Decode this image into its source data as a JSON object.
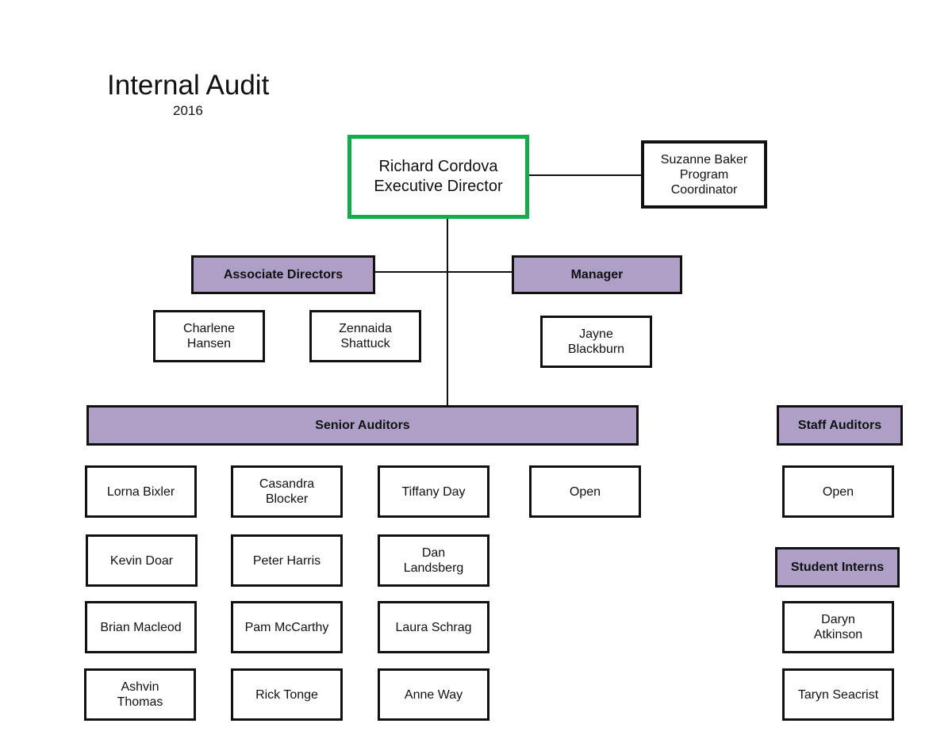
{
  "title": "Internal Audit",
  "year": "2016",
  "colors": {
    "executive_border": "#12ad4b",
    "header_fill": "#ae9fc6",
    "border": "#111111"
  },
  "executive": {
    "name": "Richard Cordova",
    "role": "Executive Director",
    "label": "Richard Cordova\nExecutive Director"
  },
  "coordinator": {
    "label": "Suzanne Baker\nProgram\nCoordinator"
  },
  "associate_directors": {
    "header": "Associate Directors",
    "members": [
      "Charlene\nHansen",
      "Zennaida\nShattuck"
    ]
  },
  "manager": {
    "header": "Manager",
    "members": [
      "Jayne\nBlackburn"
    ]
  },
  "senior_auditors": {
    "header": "Senior Auditors",
    "members": [
      "Lorna Bixler",
      "Casandra\nBlocker",
      "Tiffany Day",
      "Open",
      "Kevin Doar",
      "Peter Harris",
      "Dan\nLandsberg",
      "Brian Macleod",
      "Pam McCarthy",
      "Laura Schrag",
      "Ashvin\nThomas",
      "Rick Tonge",
      "Anne Way"
    ]
  },
  "staff_auditors": {
    "header": "Staff Auditors",
    "members": [
      "Open"
    ]
  },
  "student_interns": {
    "header": "Student Interns",
    "members": [
      "Daryn\nAtkinson",
      "Taryn Seacrist"
    ]
  }
}
